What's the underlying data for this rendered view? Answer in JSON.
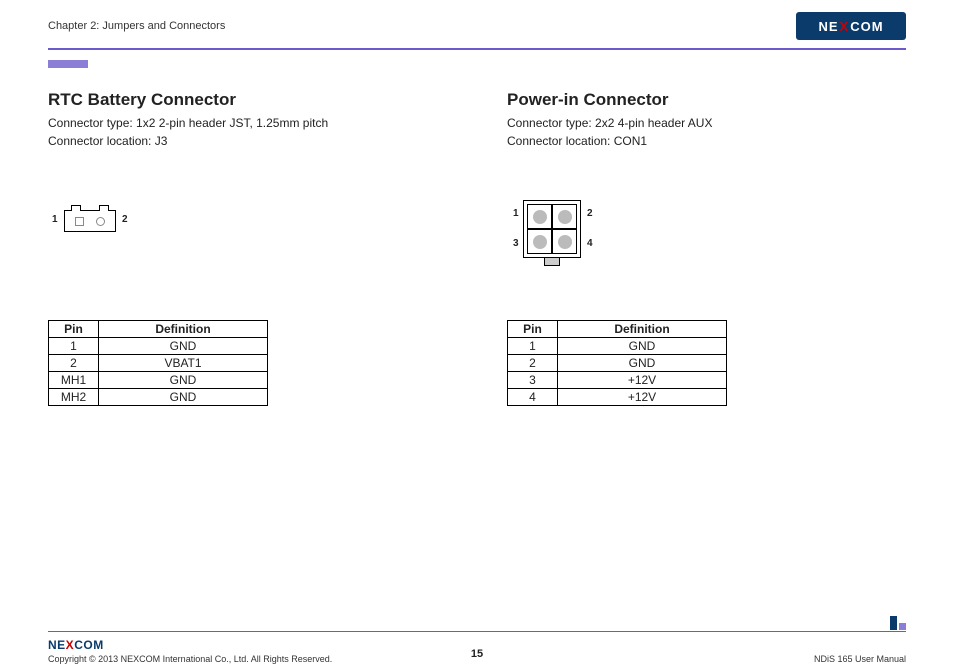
{
  "header": {
    "chapter": "Chapter 2: Jumpers and Connectors",
    "brand_pre": "NE",
    "brand_x": "X",
    "brand_post": "COM"
  },
  "rtc": {
    "title": "RTC Battery Connector",
    "type_line": "Connector type: 1x2 2-pin header JST, 1.25mm pitch",
    "loc_line": "Connector location: J3",
    "diag": {
      "left": "1",
      "right": "2"
    },
    "th_pin": "Pin",
    "th_def": "Definition",
    "rows": [
      {
        "pin": "1",
        "def": "GND"
      },
      {
        "pin": "2",
        "def": "VBAT1"
      },
      {
        "pin": "MH1",
        "def": "GND"
      },
      {
        "pin": "MH2",
        "def": "GND"
      }
    ]
  },
  "pwr": {
    "title": "Power-in Connector",
    "type_line": "Connector type: 2x2 4-pin header AUX",
    "loc_line": "Connector location: CON1",
    "diag": {
      "tl": "1",
      "tr": "2",
      "bl": "3",
      "br": "4"
    },
    "th_pin": "Pin",
    "th_def": "Definition",
    "rows": [
      {
        "pin": "1",
        "def": "GND"
      },
      {
        "pin": "2",
        "def": "GND"
      },
      {
        "pin": "3",
        "def": "+12V"
      },
      {
        "pin": "4",
        "def": "+12V"
      }
    ]
  },
  "footer": {
    "brand_pre": "NE",
    "brand_x": "X",
    "brand_post": "COM",
    "copyright": "Copyright © 2013 NEXCOM International Co., Ltd. All Rights Reserved.",
    "page": "15",
    "manual": "NDiS 165 User Manual"
  }
}
